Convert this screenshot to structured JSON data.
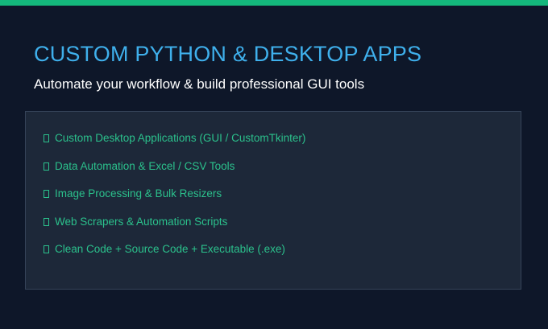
{
  "header": {
    "title": "CUSTOM PYTHON & DESKTOP APPS",
    "subtitle": "Automate your workflow & build professional GUI tools"
  },
  "features": {
    "icon": "missing-glyph-box-icon",
    "items": [
      "Custom Desktop Applications (GUI / CustomTkinter)",
      "Data Automation & Excel / CSV Tools",
      "Image Processing & Bulk Resizers",
      "Web Scrapers & Automation Scripts",
      "Clean Code + Source Code + Executable (.exe)"
    ]
  },
  "colors": {
    "background": "#0e1729",
    "accent_bar": "#14b87c",
    "title": "#3fb0ec",
    "subtitle": "#ffffff",
    "panel": "#1d2839",
    "panel_border": "#354358",
    "feature_text": "#2bc18c"
  }
}
